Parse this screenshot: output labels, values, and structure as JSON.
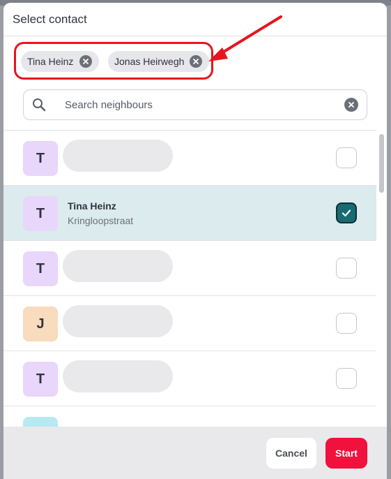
{
  "dialog": {
    "title": "Select contact"
  },
  "selected_chips": [
    {
      "label": "Tina Heinz"
    },
    {
      "label": "Jonas Heirwegh"
    }
  ],
  "search": {
    "placeholder": "Search neighbours",
    "value": ""
  },
  "contacts": [
    {
      "initial": "T",
      "name": "",
      "street": "",
      "checked": false,
      "avatar_color": "#e9d6fb"
    },
    {
      "initial": "T",
      "name": "Tina Heinz",
      "street": "Kringloopstraat",
      "checked": true,
      "avatar_color": "#e9d6fb"
    },
    {
      "initial": "T",
      "name": "",
      "street": "",
      "checked": false,
      "avatar_color": "#e9d6fb"
    },
    {
      "initial": "J",
      "name": "",
      "street": "",
      "checked": false,
      "avatar_color": "#f9dbbd"
    },
    {
      "initial": "T",
      "name": "",
      "street": "",
      "checked": false,
      "avatar_color": "#e9d6fb"
    },
    {
      "initial": "",
      "name": "",
      "street": "",
      "checked": false,
      "avatar_color": "#b8e9f0"
    }
  ],
  "footer": {
    "cancel_label": "Cancel",
    "start_label": "Start"
  },
  "colors": {
    "accent": "#f0113c",
    "checked": "#176b72",
    "highlight": "#e8141e"
  }
}
